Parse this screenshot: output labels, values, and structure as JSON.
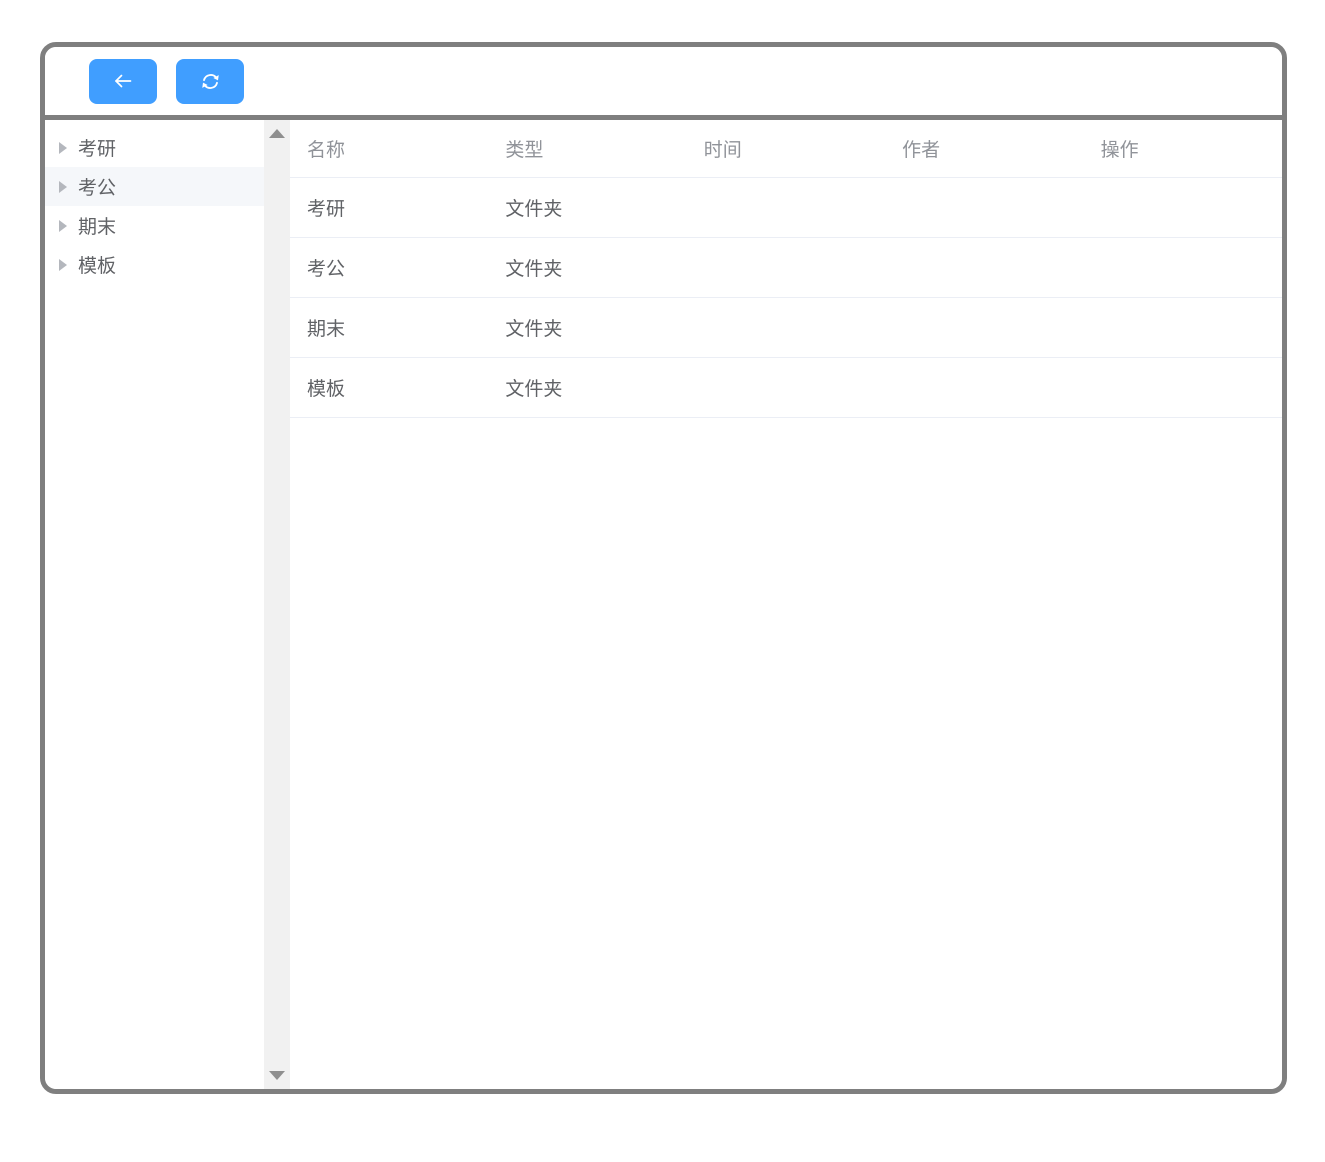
{
  "toolbar": {
    "buttons": [
      {
        "name": "back",
        "icon": "arrow-left-icon"
      },
      {
        "name": "refresh",
        "icon": "refresh-icon"
      }
    ]
  },
  "sidebar": {
    "items": [
      {
        "label": "考研",
        "state": "collapsed",
        "highlighted": false
      },
      {
        "label": "考公",
        "state": "collapsed",
        "highlighted": true
      },
      {
        "label": "期末",
        "state": "collapsed",
        "highlighted": false
      },
      {
        "label": "模板",
        "state": "collapsed",
        "highlighted": false
      }
    ],
    "caret_icon": "caret-right"
  },
  "scrollbar": {
    "up_icon": "triangle-up",
    "down_icon": "triangle-down"
  },
  "table": {
    "columns": [
      "名称",
      "类型",
      "时间",
      "作者",
      "操作"
    ],
    "rows": [
      {
        "name": "考研",
        "type": "文件夹",
        "time": "",
        "author": "",
        "action": ""
      },
      {
        "name": "考公",
        "type": "文件夹",
        "time": "",
        "author": "",
        "action": ""
      },
      {
        "name": "期末",
        "type": "文件夹",
        "time": "",
        "author": "",
        "action": ""
      },
      {
        "name": "模板",
        "type": "文件夹",
        "time": "",
        "author": "",
        "action": ""
      }
    ]
  },
  "colors": {
    "primary_button": "#409EFF",
    "window_frame": "#7f7f7f",
    "header_text": "#909399",
    "cell_text": "#606266",
    "row_border": "#ebeef5",
    "tree_highlight_bg": "#f5f7fa",
    "scrollbar_track": "#f1f1f1",
    "scrollbar_arrow": "#8f8f8f"
  }
}
